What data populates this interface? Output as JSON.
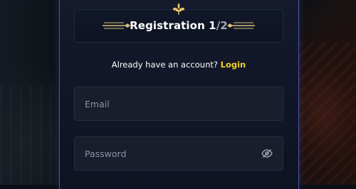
{
  "header": {
    "title_main": "Registration 1",
    "title_step": "/2",
    "icon": "fleur-de-lis-icon"
  },
  "account_prompt": {
    "text": "Already have an account? ",
    "login_link": "Login"
  },
  "form": {
    "email": {
      "placeholder": "Email",
      "value": ""
    },
    "password": {
      "placeholder": "Password",
      "value": "",
      "toggle_icon": "eye-off-icon"
    }
  },
  "colors": {
    "accent": "#f3d023",
    "panel_border": "#4a55a8",
    "field_bg": "#181e2c"
  }
}
